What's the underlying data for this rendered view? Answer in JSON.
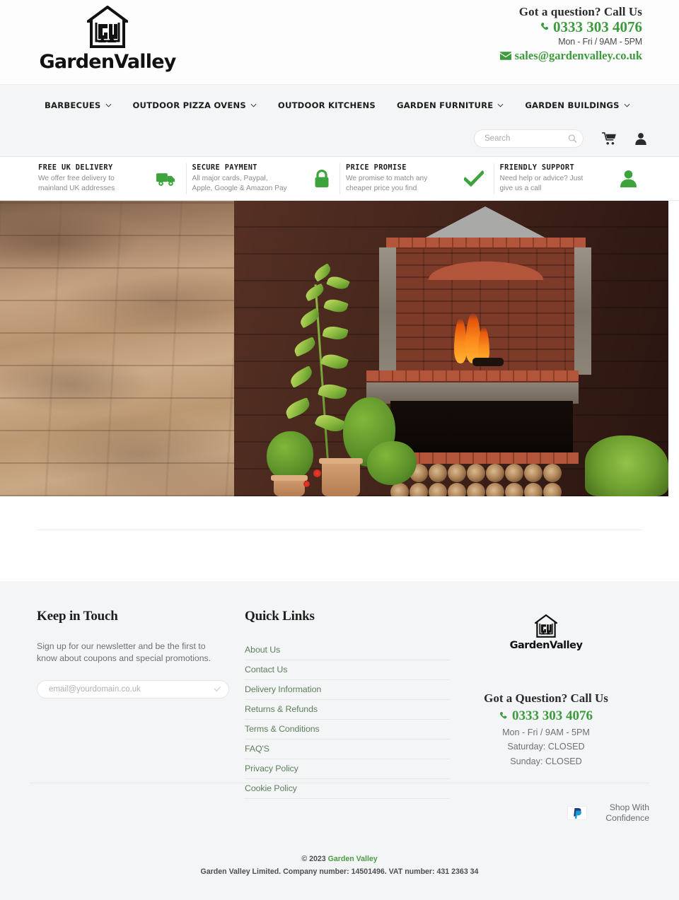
{
  "brand": {
    "name": "GardenValley",
    "logo_icon": "house-gv-monogram-logo",
    "accent_green": "#3d9b3d",
    "nav_bg": "#f4f5f6"
  },
  "header": {
    "contact_question": "Got a question? Call Us",
    "phone": "0333 303 4076",
    "phone_icon": "phone-icon",
    "hours": "Mon - Fri / 9AM - 5PM",
    "email": "sales@gardenvalley.co.uk",
    "email_icon": "envelope-icon"
  },
  "nav": {
    "items": [
      {
        "label": "BARBECUES",
        "has_dropdown": true
      },
      {
        "label": "OUTDOOR PIZZA OVENS",
        "has_dropdown": true
      },
      {
        "label": "OUTDOOR KITCHENS",
        "has_dropdown": false
      },
      {
        "label": "GARDEN FURNITURE",
        "has_dropdown": true
      },
      {
        "label": "GARDEN BUILDINGS",
        "has_dropdown": true
      }
    ],
    "search_placeholder": "Search",
    "search_value": "",
    "search_icon": "search-icon",
    "cart_icon": "shopping-cart-icon",
    "account_icon": "user-account-icon"
  },
  "trust": {
    "items": [
      {
        "title": "FREE UK DELIVERY",
        "desc": "We offer free delivery to mainland UK addresses",
        "icon": "delivery-truck-icon"
      },
      {
        "title": "SECURE PAYMENT",
        "desc": "All major cards, Paypal, Apple, Google & Amazon Pay",
        "icon": "padlock-icon"
      },
      {
        "title": "PRICE PROMISE",
        "desc": "We promise to match any cheaper price you find",
        "icon": "checkmark-icon"
      },
      {
        "title": "FRIENDLY SUPPORT",
        "desc": "Need help or advice? Just give us a call",
        "icon": "person-support-icon"
      }
    ]
  },
  "hero": {
    "alt_left": "sandstone-wall-texture",
    "alt_right": "brick-barbecue-with-fire-and-garden-plants"
  },
  "footer": {
    "keep_in_touch": {
      "heading": "Keep in Touch",
      "paragraph": "Sign up for our newsletter and be the first to know about coupons and special promotions.",
      "email_placeholder": "email@yourdomain.co.uk",
      "email_value": "",
      "submit_icon": "chevron-submit-icon"
    },
    "quick_links": {
      "heading": "Quick Links",
      "items": [
        "About Us",
        "Contact Us",
        "Delivery Information",
        "Returns & Refunds",
        "Terms & Conditions",
        "FAQ'S",
        "Privacy Policy",
        "Cookie Policy"
      ]
    },
    "info": {
      "logo_name": "GardenValley",
      "question": "Got a Question? Call Us",
      "phone": "0333 303 4076",
      "phone_icon": "phone-icon",
      "hours_weekday": "Mon - Fri / 9AM - 5PM",
      "hours_saturday": "Saturday: CLOSED",
      "hours_sunday": "Sunday: CLOSED"
    },
    "payment": {
      "badge_icon": "paypal-icon",
      "label": "Shop With Confidence"
    },
    "copyright": {
      "line1_prefix": "© 2023 ",
      "line1_brand": "Garden Valley",
      "line2": "Garden Valley Limited. Company number: 14501496. VAT number: 431 2363 34"
    }
  }
}
